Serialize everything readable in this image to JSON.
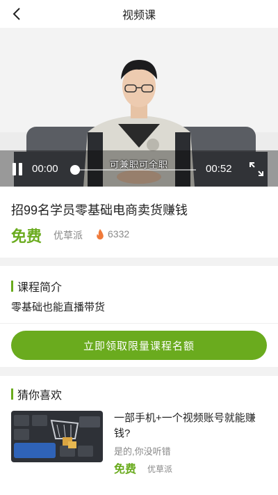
{
  "header": {
    "title": "视频课"
  },
  "player": {
    "subtitle": "可兼职可全职",
    "current_time": "00:00",
    "total_time": "00:52",
    "progress": 0
  },
  "course": {
    "title": "招99名学员零基础电商卖货赚钱",
    "price": "免费",
    "author": "优草派",
    "views": "6332"
  },
  "intro": {
    "heading": "课程简介",
    "description": "零基础也能直播带货",
    "cta_label": "立即领取限量课程名额"
  },
  "recommend": {
    "heading": "猜你喜欢",
    "items": [
      {
        "title": "一部手机+一个视频账号就能赚钱?",
        "subtitle": "是的,你没听错",
        "price": "免费",
        "author": "优草派"
      }
    ]
  },
  "colors": {
    "accent": "#6aab1e",
    "fire": "#f07a3a"
  }
}
